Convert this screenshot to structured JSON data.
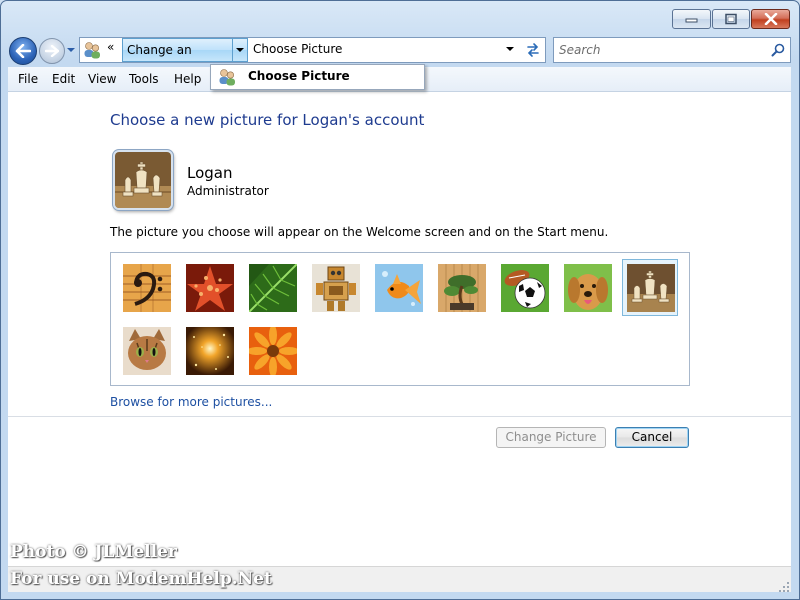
{
  "window": {
    "caption_buttons": [
      "minimize",
      "maximize",
      "close"
    ]
  },
  "nav": {
    "back_icon": "arrow-left-icon",
    "forward_icon": "arrow-right-icon"
  },
  "address": {
    "chevron": "«",
    "breadcrumb": "Change an Account",
    "current": "Choose Picture"
  },
  "search": {
    "placeholder": "Search"
  },
  "menu": {
    "file": "File",
    "edit": "Edit",
    "view": "View",
    "tools": "Tools",
    "help": "Help"
  },
  "dropdown": {
    "item": "Choose Picture"
  },
  "main": {
    "title": "Choose a new picture for Logan's account",
    "user_name": "Logan",
    "user_role": "Administrator",
    "description": "The picture you choose will appear on the Welcome screen and on the Start menu.",
    "pictures": [
      "bass-clef",
      "starfish",
      "leaf",
      "robot",
      "goldfish",
      "bonsai",
      "soccer-ball",
      "dog",
      "chess",
      "kitten",
      "sparkles",
      "daisy"
    ],
    "selected_picture": "chess",
    "browse_link": "Browse for more pictures..."
  },
  "buttons": {
    "change": "Change Picture",
    "cancel": "Cancel"
  },
  "watermark": {
    "line1": "Photo © JLMeller",
    "line2": "For use on ModemHelp.Net"
  }
}
